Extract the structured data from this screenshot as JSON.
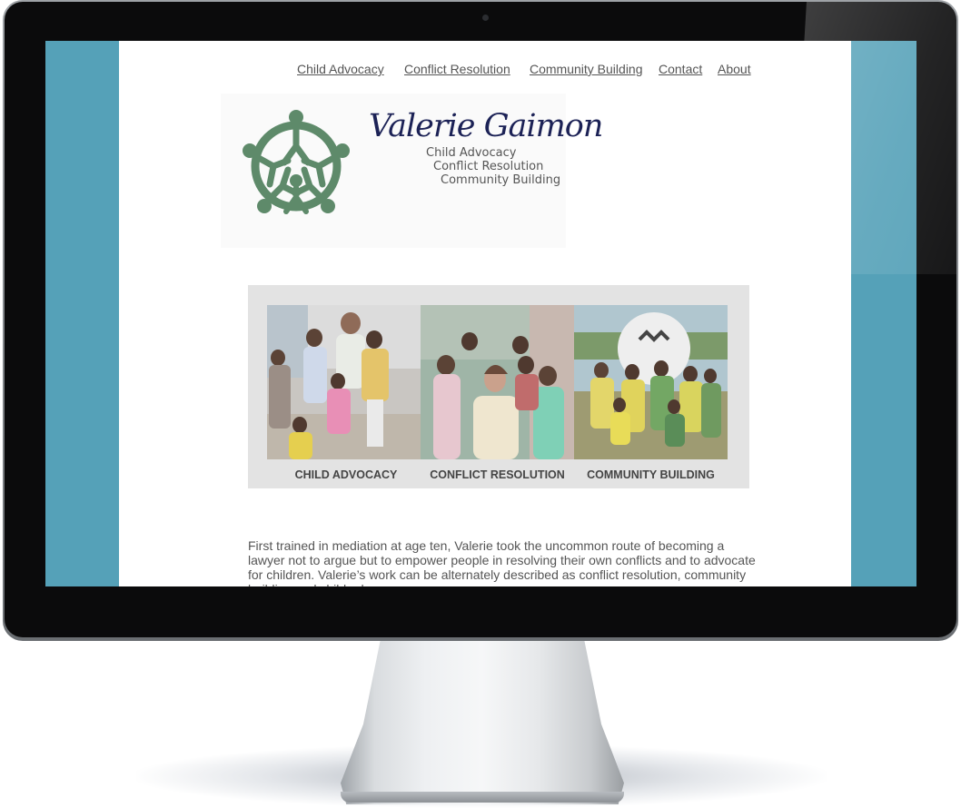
{
  "nav": {
    "links": [
      {
        "label": "Child Advocacy"
      },
      {
        "label": "Conflict Resolution"
      },
      {
        "label": "Community Building"
      },
      {
        "label": "Contact"
      },
      {
        "label": "About"
      }
    ]
  },
  "logo": {
    "name": "Valerie Gaimon",
    "taglines": [
      "Child Advocacy",
      "Conflict Resolution",
      "Community Building"
    ]
  },
  "panels": [
    {
      "label": "CHILD ADVOCACY"
    },
    {
      "label": "CONFLICT RESOLUTION"
    },
    {
      "label": "COMMUNITY BUILDING"
    }
  ],
  "intro": "First trained in mediation at age ten, Valerie took the uncommon route of becoming a lawyer not to argue but to empower people in resolving their own conflicts and to advocate for children. Valerie’s work can be alternately described as conflict resolution, community building and child advocacy.",
  "colors": {
    "screen_background": "#55a1b8",
    "logo_green": "#5e8a6a",
    "logo_navy": "#1c2256",
    "bezel": "#0b0b0c"
  }
}
